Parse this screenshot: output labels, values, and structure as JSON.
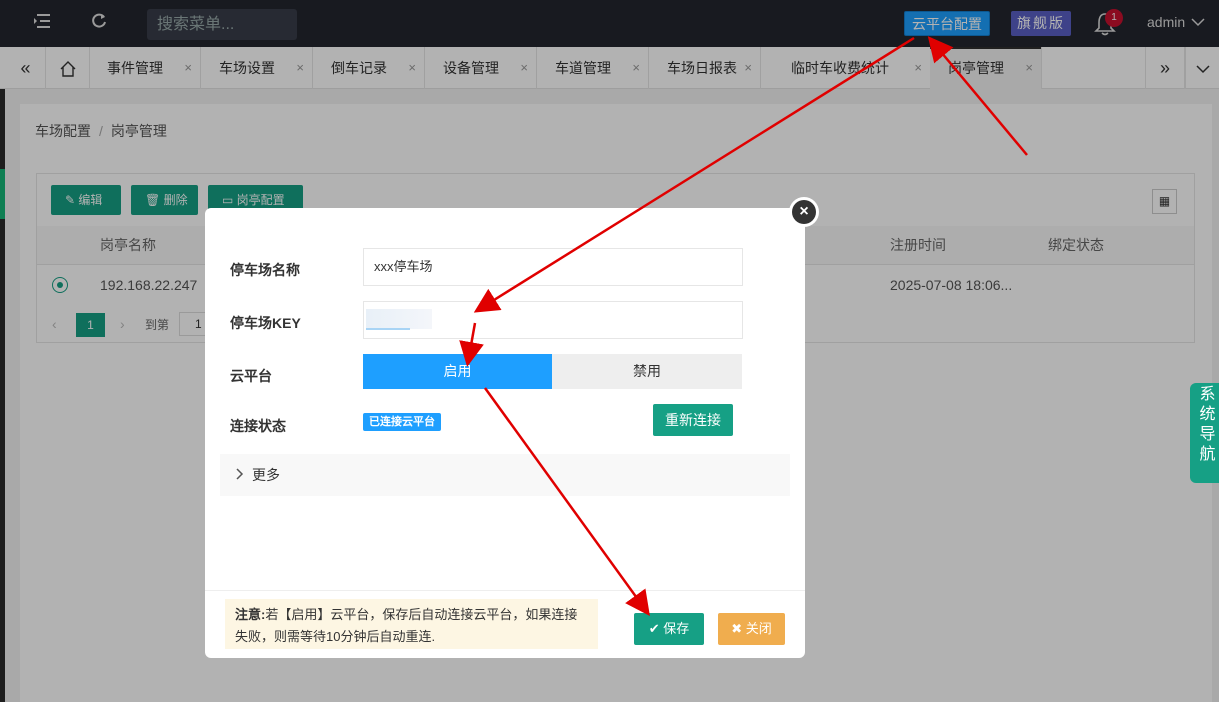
{
  "topbar": {
    "search_placeholder": "搜索菜单...",
    "cloud_config_label": "云平台配置",
    "flagship_label": "旗舰版",
    "notification_count": "1",
    "user": "admin"
  },
  "tabs": [
    {
      "label": "事件管理",
      "close": "×"
    },
    {
      "label": "车场设置",
      "close": "×"
    },
    {
      "label": "倒车记录",
      "close": "×"
    },
    {
      "label": "设备管理",
      "close": "×"
    },
    {
      "label": "车道管理",
      "close": "×"
    },
    {
      "label": "车场日报表",
      "close": "×"
    },
    {
      "label": "临时车收费统计",
      "close": "×"
    },
    {
      "label": "岗亭管理",
      "close": "×",
      "active": true
    }
  ],
  "breadcrumb": {
    "parent": "车场配置",
    "sep": "/",
    "current": "岗亭管理"
  },
  "toolbar": {
    "edit": "编辑",
    "delete": "删除",
    "booth_config": "岗亭配置"
  },
  "table": {
    "headers": {
      "name": "岗亭名称",
      "reg_time": "注册时间",
      "bind_status": "绑定状态"
    },
    "rows": [
      {
        "name": "192.168.22.247",
        "reg_time": "2025-07-08 18:06...",
        "bind_status": ""
      }
    ]
  },
  "pager": {
    "current": "1",
    "goto_label": "到第",
    "goto_value": "1"
  },
  "side_nav": "系统导航",
  "modal": {
    "parking_name_label": "停车场名称",
    "parking_name_value": "xxx停车场",
    "parking_key_label": "停车场KEY",
    "cloud_label": "云平台",
    "enable_label": "启用",
    "disable_label": "禁用",
    "cloud_enabled": true,
    "conn_status_label": "连接状态",
    "conn_status_value": "已连接云平台",
    "reconnect_label": "重新连接",
    "more_label": "更多",
    "note_title": "注意:",
    "note_text": "若【启用】云平台，保存后自动连接云平台，如果连接失败，则需等待10分钟后自动重连.",
    "save_label": "保存",
    "close_label": "关闭"
  },
  "colors": {
    "accent_blue": "#1e9fff",
    "accent_green": "#16a085",
    "warning_orange": "#f0ad4e",
    "annotation_red": "#e00000"
  }
}
